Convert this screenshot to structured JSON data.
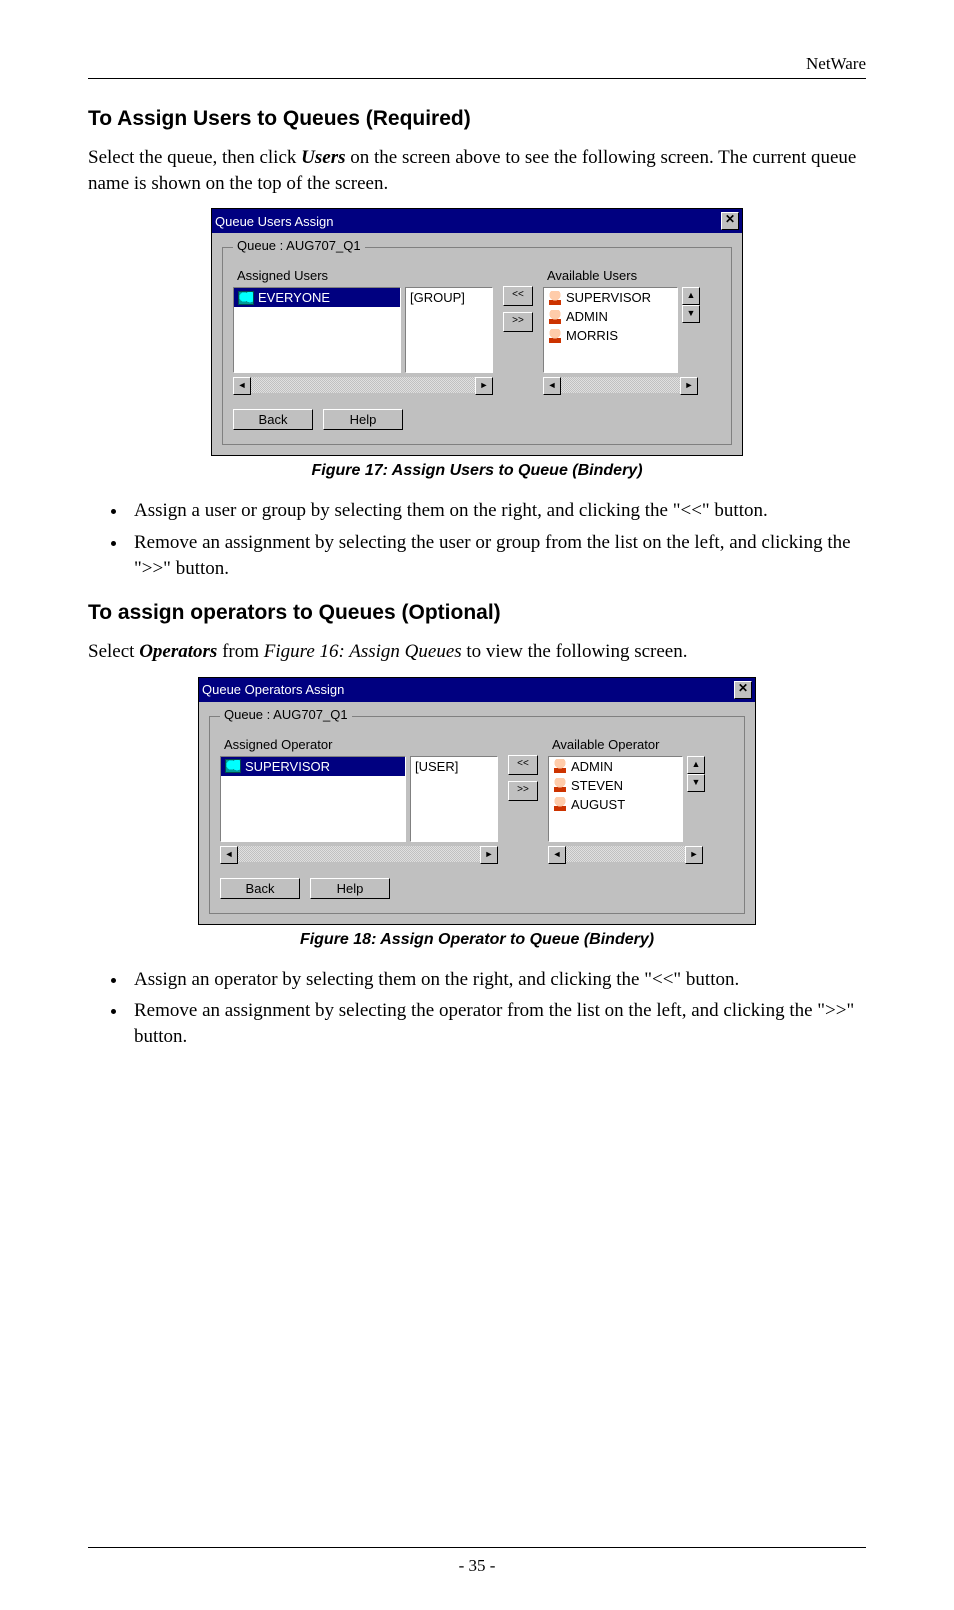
{
  "header": {
    "brand": "NetWare"
  },
  "section1": {
    "heading": "To Assign Users to Queues (Required)",
    "intro_pre": "Select the queue, then click ",
    "intro_em": "Users",
    "intro_post": " on the screen above to see the following screen. The current queue name is shown on the top of the screen."
  },
  "fig17": {
    "title": "Queue Users Assign",
    "legend": "Queue : AUG707_Q1",
    "assigned_header": "Assigned Users",
    "available_header": "Available Users",
    "assigned": [
      {
        "name": "EVERYONE",
        "type": "[GROUP]",
        "selected": true,
        "icon": "group"
      }
    ],
    "available": [
      {
        "name": "SUPERVISOR",
        "icon": "user"
      },
      {
        "name": "ADMIN",
        "icon": "user"
      },
      {
        "name": "MORRIS",
        "icon": "user"
      }
    ],
    "btn_left": "<<",
    "btn_right": ">>",
    "back": "Back",
    "help": "Help",
    "caption": "Figure 17: Assign Users to Queue (Bindery)"
  },
  "bullets1": {
    "b1": "Assign a user or group by selecting them on the right, and clicking the \"<<\" button.",
    "b2": "Remove an assignment by selecting the user or group from the list on the left, and clicking the \">>\" button."
  },
  "section2": {
    "heading": "To assign operators to Queues (Optional)",
    "intro_pre": "Select ",
    "intro_em1": "Operators",
    "intro_mid": " from ",
    "intro_em2": "Figure 16: Assign Queues",
    "intro_post": " to view the following screen."
  },
  "fig18": {
    "title": "Queue Operators Assign",
    "legend": "Queue : AUG707_Q1",
    "assigned_header": "Assigned Operator",
    "available_header": "Available Operator",
    "assigned": [
      {
        "name": "SUPERVISOR",
        "type": "[USER]",
        "selected": true,
        "icon": "group"
      }
    ],
    "available": [
      {
        "name": "ADMIN",
        "icon": "user"
      },
      {
        "name": "STEVEN",
        "icon": "user"
      },
      {
        "name": "AUGUST",
        "icon": "user"
      }
    ],
    "btn_left": "<<",
    "btn_right": ">>",
    "back": "Back",
    "help": "Help",
    "caption": "Figure 18: Assign Operator to Queue (Bindery)"
  },
  "bullets2": {
    "b1": "Assign an operator by selecting them on the right, and clicking the \"<<\" button.",
    "b2": "Remove an assignment by selecting the operator from the list on the left, and clicking the \">>\" button."
  },
  "footer": {
    "pagenum": "- 35 -"
  }
}
